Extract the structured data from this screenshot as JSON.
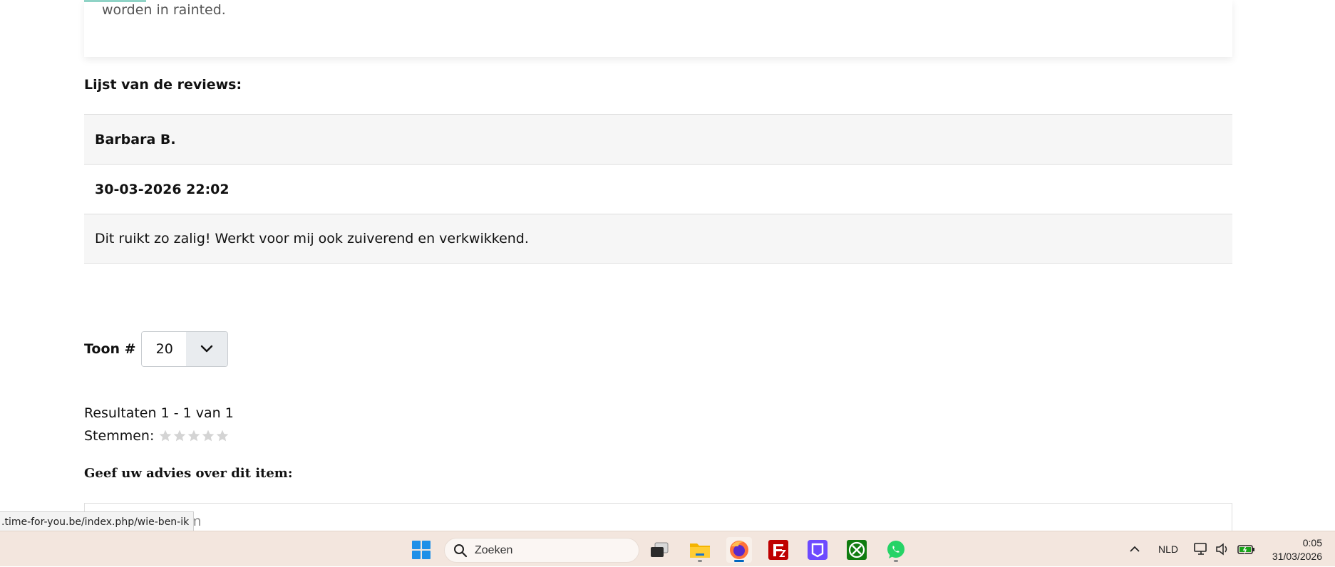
{
  "top_card": {
    "clipped_text": "worden in rainted."
  },
  "reviews": {
    "section_title": "Lijst van de reviews:",
    "rows": [
      {
        "author": "Barbara B.",
        "date": "30-03-2026 22:02",
        "text": "Dit ruikt zo zalig! Werkt voor mij ook zuiverend en verkwikkend."
      }
    ]
  },
  "pagination": {
    "show_label": "Toon #",
    "show_value": "20",
    "results_text": "Resultaten 1 - 1 van 1"
  },
  "rating": {
    "label": "Stemmen:",
    "stars_total": 5,
    "stars_filled": 0
  },
  "advice": {
    "heading": "Geef uw advies over dit item:",
    "name_field_placeholder_visible": "m"
  },
  "status_bar": {
    "url": ".time-for-you.be/index.php/wie-ben-ik"
  },
  "taskbar": {
    "search_placeholder": "Zoeken",
    "language": "NLD",
    "time": "0:05",
    "date": "31/03/2026",
    "apps": [
      "windows-start-icon",
      "task-view-icon",
      "file-explorer-icon",
      "firefox-icon",
      "filezilla-icon",
      "proton-vpn-icon",
      "xbox-icon",
      "whatsapp-icon"
    ]
  },
  "colors": {
    "accent_teal": "#8fd3c6",
    "row_shaded": "#f6f6f6",
    "taskbar_bg": "#f3e6de",
    "star_empty": "#cfcfcf"
  }
}
